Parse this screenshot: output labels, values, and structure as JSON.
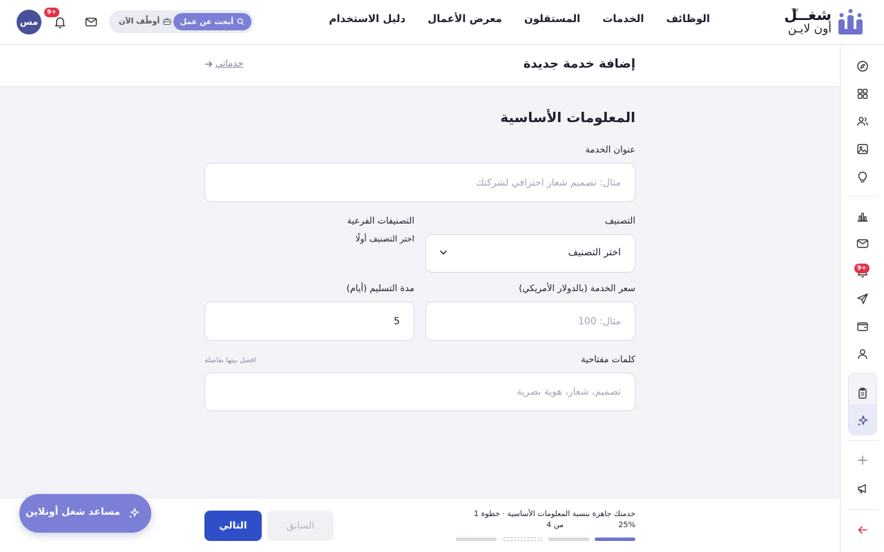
{
  "brand": {
    "line1": "شغــل",
    "line2": "أون لايـن",
    "tm": "TM"
  },
  "nav": {
    "items": [
      "الوظائف",
      "الخدمات",
      "المستقلون",
      "معرض الأعمال",
      "دليل الاستخدام"
    ]
  },
  "cta": {
    "search_job": "أبحث عن عمل",
    "hire_now": "أوظّف الآن"
  },
  "user": {
    "initials": "مس",
    "notifications_badge": "+9"
  },
  "page": {
    "title": "إضافة خدمة جديدة",
    "back_link": "خدماتي"
  },
  "form": {
    "section_title": "المعلومات الأساسية",
    "service_title": {
      "label": "عنوان الخدمة",
      "placeholder": "مثال: تصميم شعار احترافي لشركتك",
      "value": ""
    },
    "category": {
      "label": "التصنيف",
      "selected": "اختر التصنيف"
    },
    "subcategories": {
      "label": "التصنيفات الفرعية",
      "hint": "اختر التصنيف أولًا"
    },
    "price": {
      "label": "سعر الخدمة (بالدولار الأمريكي)",
      "placeholder": "مثال: 100",
      "value": ""
    },
    "delivery": {
      "label": "مدة التسليم (أيام)",
      "value": "5"
    },
    "keywords": {
      "label": "كلمات مفتاحية",
      "hint": "افصل بينها بفاصلة",
      "placeholder": "تصميم، شعار، هوية بصرية",
      "value": ""
    }
  },
  "footer": {
    "progress_text": "خدمتك جاهزة بنسبة المعلومات الأساسية · خطوة 1",
    "progress_percent": "25%",
    "progress_of": "من 4",
    "progress_fraction": 0.25,
    "step_current": 1,
    "step_total": 4,
    "next_label": "التالي",
    "prev_label": "السابق"
  },
  "assistant": {
    "label": "مساعد شغل أونلاين"
  },
  "sidebar": {
    "icons": [
      "compass-icon",
      "grid-icon",
      "users-icon",
      "image-icon",
      "lightbulb-icon",
      "chart-icon",
      "mail-icon",
      "bell-icon",
      "send-icon",
      "wallet-icon",
      "profile-icon",
      "clipboard-icon",
      "sparkles-icon",
      "plus-icon",
      "megaphone-icon",
      "logout-icon"
    ],
    "bell_badge": "+9"
  },
  "colors": {
    "accent": "#7b7fd6",
    "primary_button": "#2e4fc8",
    "badge": "#e0334a",
    "text": "#1f1f2e"
  }
}
